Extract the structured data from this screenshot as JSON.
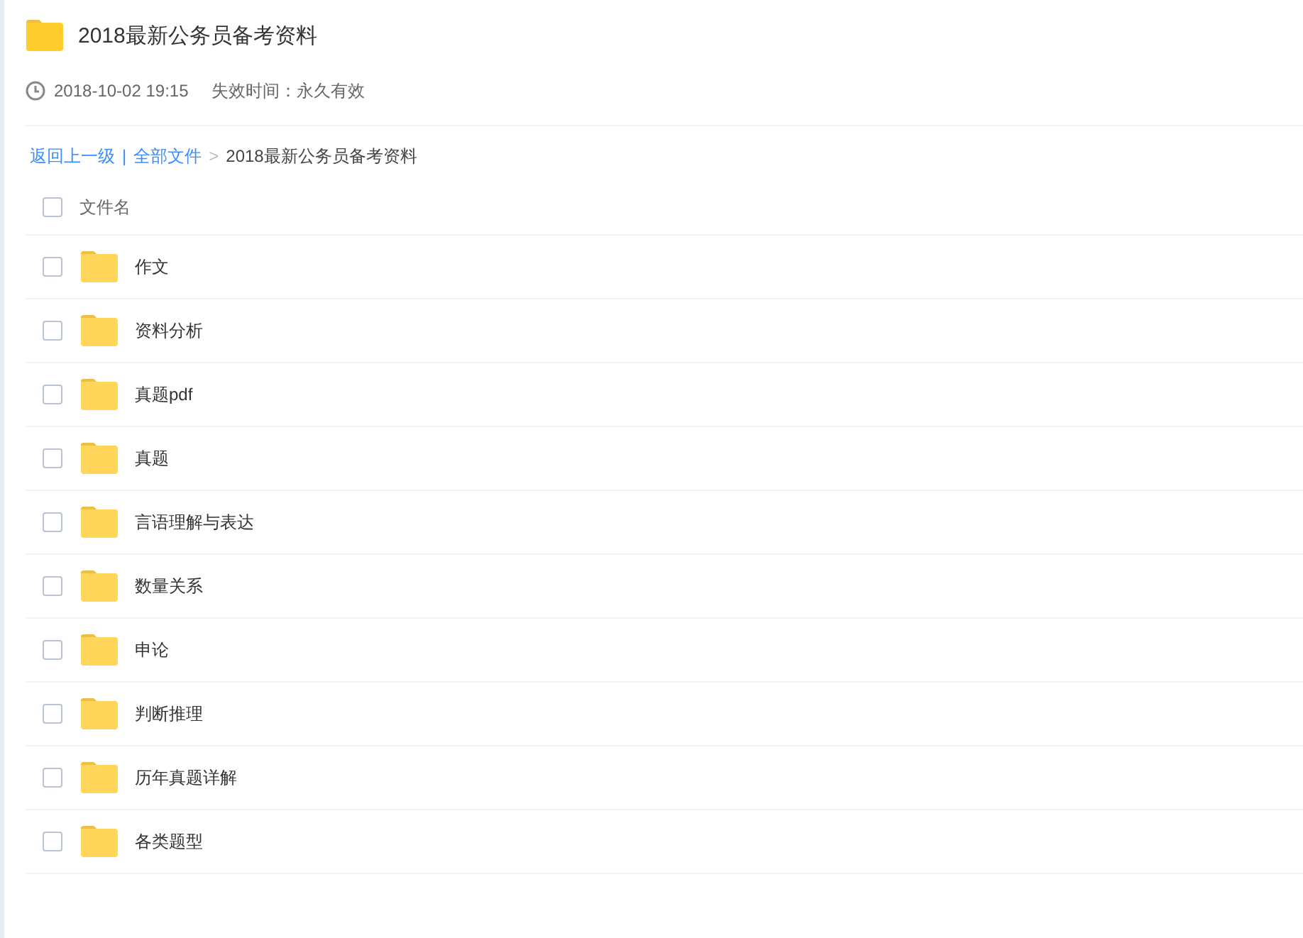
{
  "title": "2018最新公务员备考资料",
  "meta": {
    "date": "2018-10-02 19:15",
    "expiry": "失效时间：永久有效"
  },
  "breadcrumb": {
    "back": "返回上一级",
    "separator": "|",
    "root": "全部文件",
    "arrow": ">",
    "current": "2018最新公务员备考资料"
  },
  "header": {
    "checked": false,
    "label": "文件名"
  },
  "files": [
    {
      "name": "作文",
      "checked": false
    },
    {
      "name": "资料分析",
      "checked": false
    },
    {
      "name": "真题pdf",
      "checked": false
    },
    {
      "name": "真题",
      "checked": false
    },
    {
      "name": "言语理解与表达",
      "checked": false
    },
    {
      "name": "数量关系",
      "checked": false
    },
    {
      "name": "申论",
      "checked": false
    },
    {
      "name": "判断推理",
      "checked": false
    },
    {
      "name": "历年真题详解",
      "checked": false
    },
    {
      "name": "各类题型",
      "checked": false
    }
  ]
}
